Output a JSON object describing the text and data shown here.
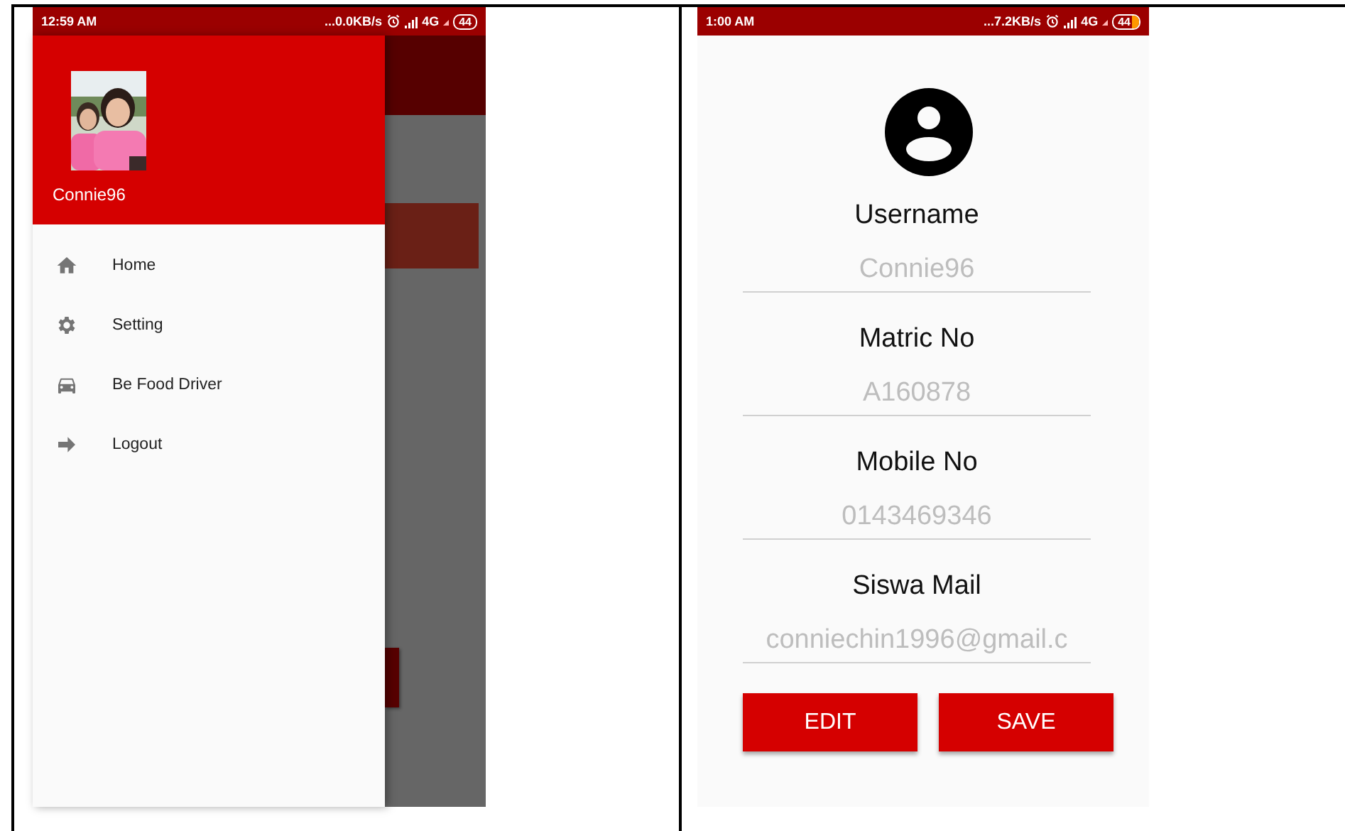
{
  "screens": [
    {
      "kind": "drawer",
      "status_bar": {
        "time": "12:59 AM",
        "speed": "...0.0KB/s",
        "network": "4G",
        "battery": "44",
        "charging": false
      },
      "drawer": {
        "username": "Connie96",
        "items": [
          {
            "label": "Home"
          },
          {
            "label": "Setting"
          },
          {
            "label": "Be Food Driver"
          },
          {
            "label": "Logout"
          }
        ]
      }
    },
    {
      "kind": "profile",
      "status_bar": {
        "time": "1:00 AM",
        "speed": "...7.2KB/s",
        "network": "4G",
        "battery": "44",
        "charging": true
      },
      "fields": [
        {
          "label": "Username",
          "value": "Connie96",
          "disabled": true
        },
        {
          "label": "Matric No",
          "value": "A160878",
          "disabled": true
        },
        {
          "label": "Mobile No",
          "value": "0143469346",
          "disabled": true
        },
        {
          "label": "Siswa Mail",
          "value": "conniechin1996@gmail.c",
          "disabled": true
        }
      ],
      "buttons": [
        "EDIT",
        "SAVE"
      ]
    }
  ]
}
